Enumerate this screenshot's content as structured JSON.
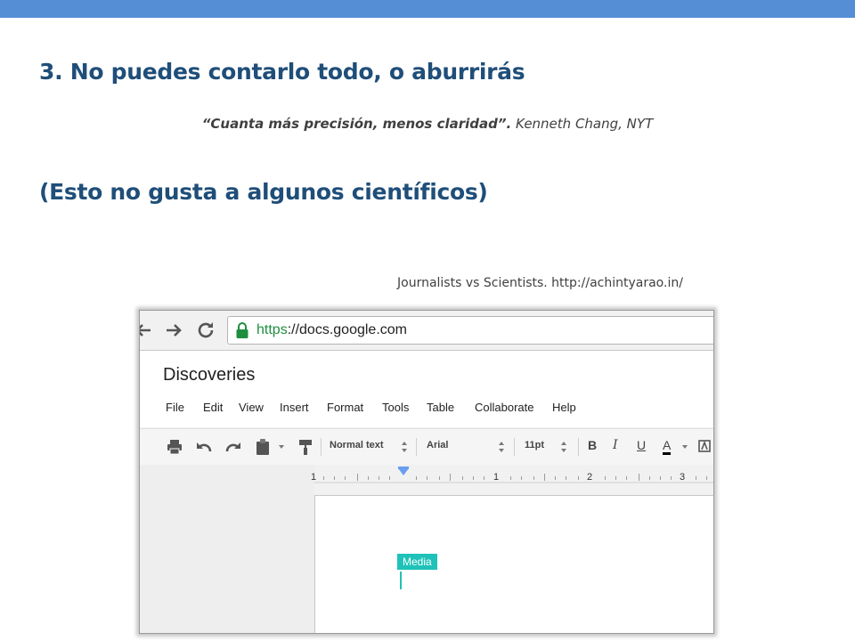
{
  "slide": {
    "title": "3. No puedes contarlo todo, o aburrirás",
    "quote": "“Cuanta más precisión, menos claridad”.",
    "quote_author": "Kenneth Chang,  NYT",
    "subtitle": "(Esto no gusta a algunos científicos)",
    "caption": "Journalists vs Scientists. http://achintyarao.in/"
  },
  "browser": {
    "url_scheme": "https",
    "url_rest": "://docs.google.com"
  },
  "docs": {
    "title": "Discoveries",
    "menu": [
      "File",
      "Edit",
      "View",
      "Insert",
      "Format",
      "Tools",
      "Table",
      "Collaborate",
      "Help"
    ],
    "toolbar": {
      "style": "Normal text",
      "font": "Arial",
      "size": "11pt",
      "bold": "B",
      "italic": "I",
      "underline": "U",
      "text_color": "A"
    },
    "ruler": [
      "1",
      "1",
      "2",
      "3"
    ],
    "media_label": "Media"
  },
  "colors": {
    "accent_bar": "#558ed5",
    "title": "#1f4e79",
    "media_tag": "#1fc2b8"
  },
  "icons": [
    "back-arrow-icon",
    "forward-arrow-icon",
    "reload-icon",
    "lock-icon",
    "print-icon",
    "undo-icon",
    "redo-icon",
    "paste-icon",
    "paint-format-icon",
    "chevron-down-icon"
  ]
}
